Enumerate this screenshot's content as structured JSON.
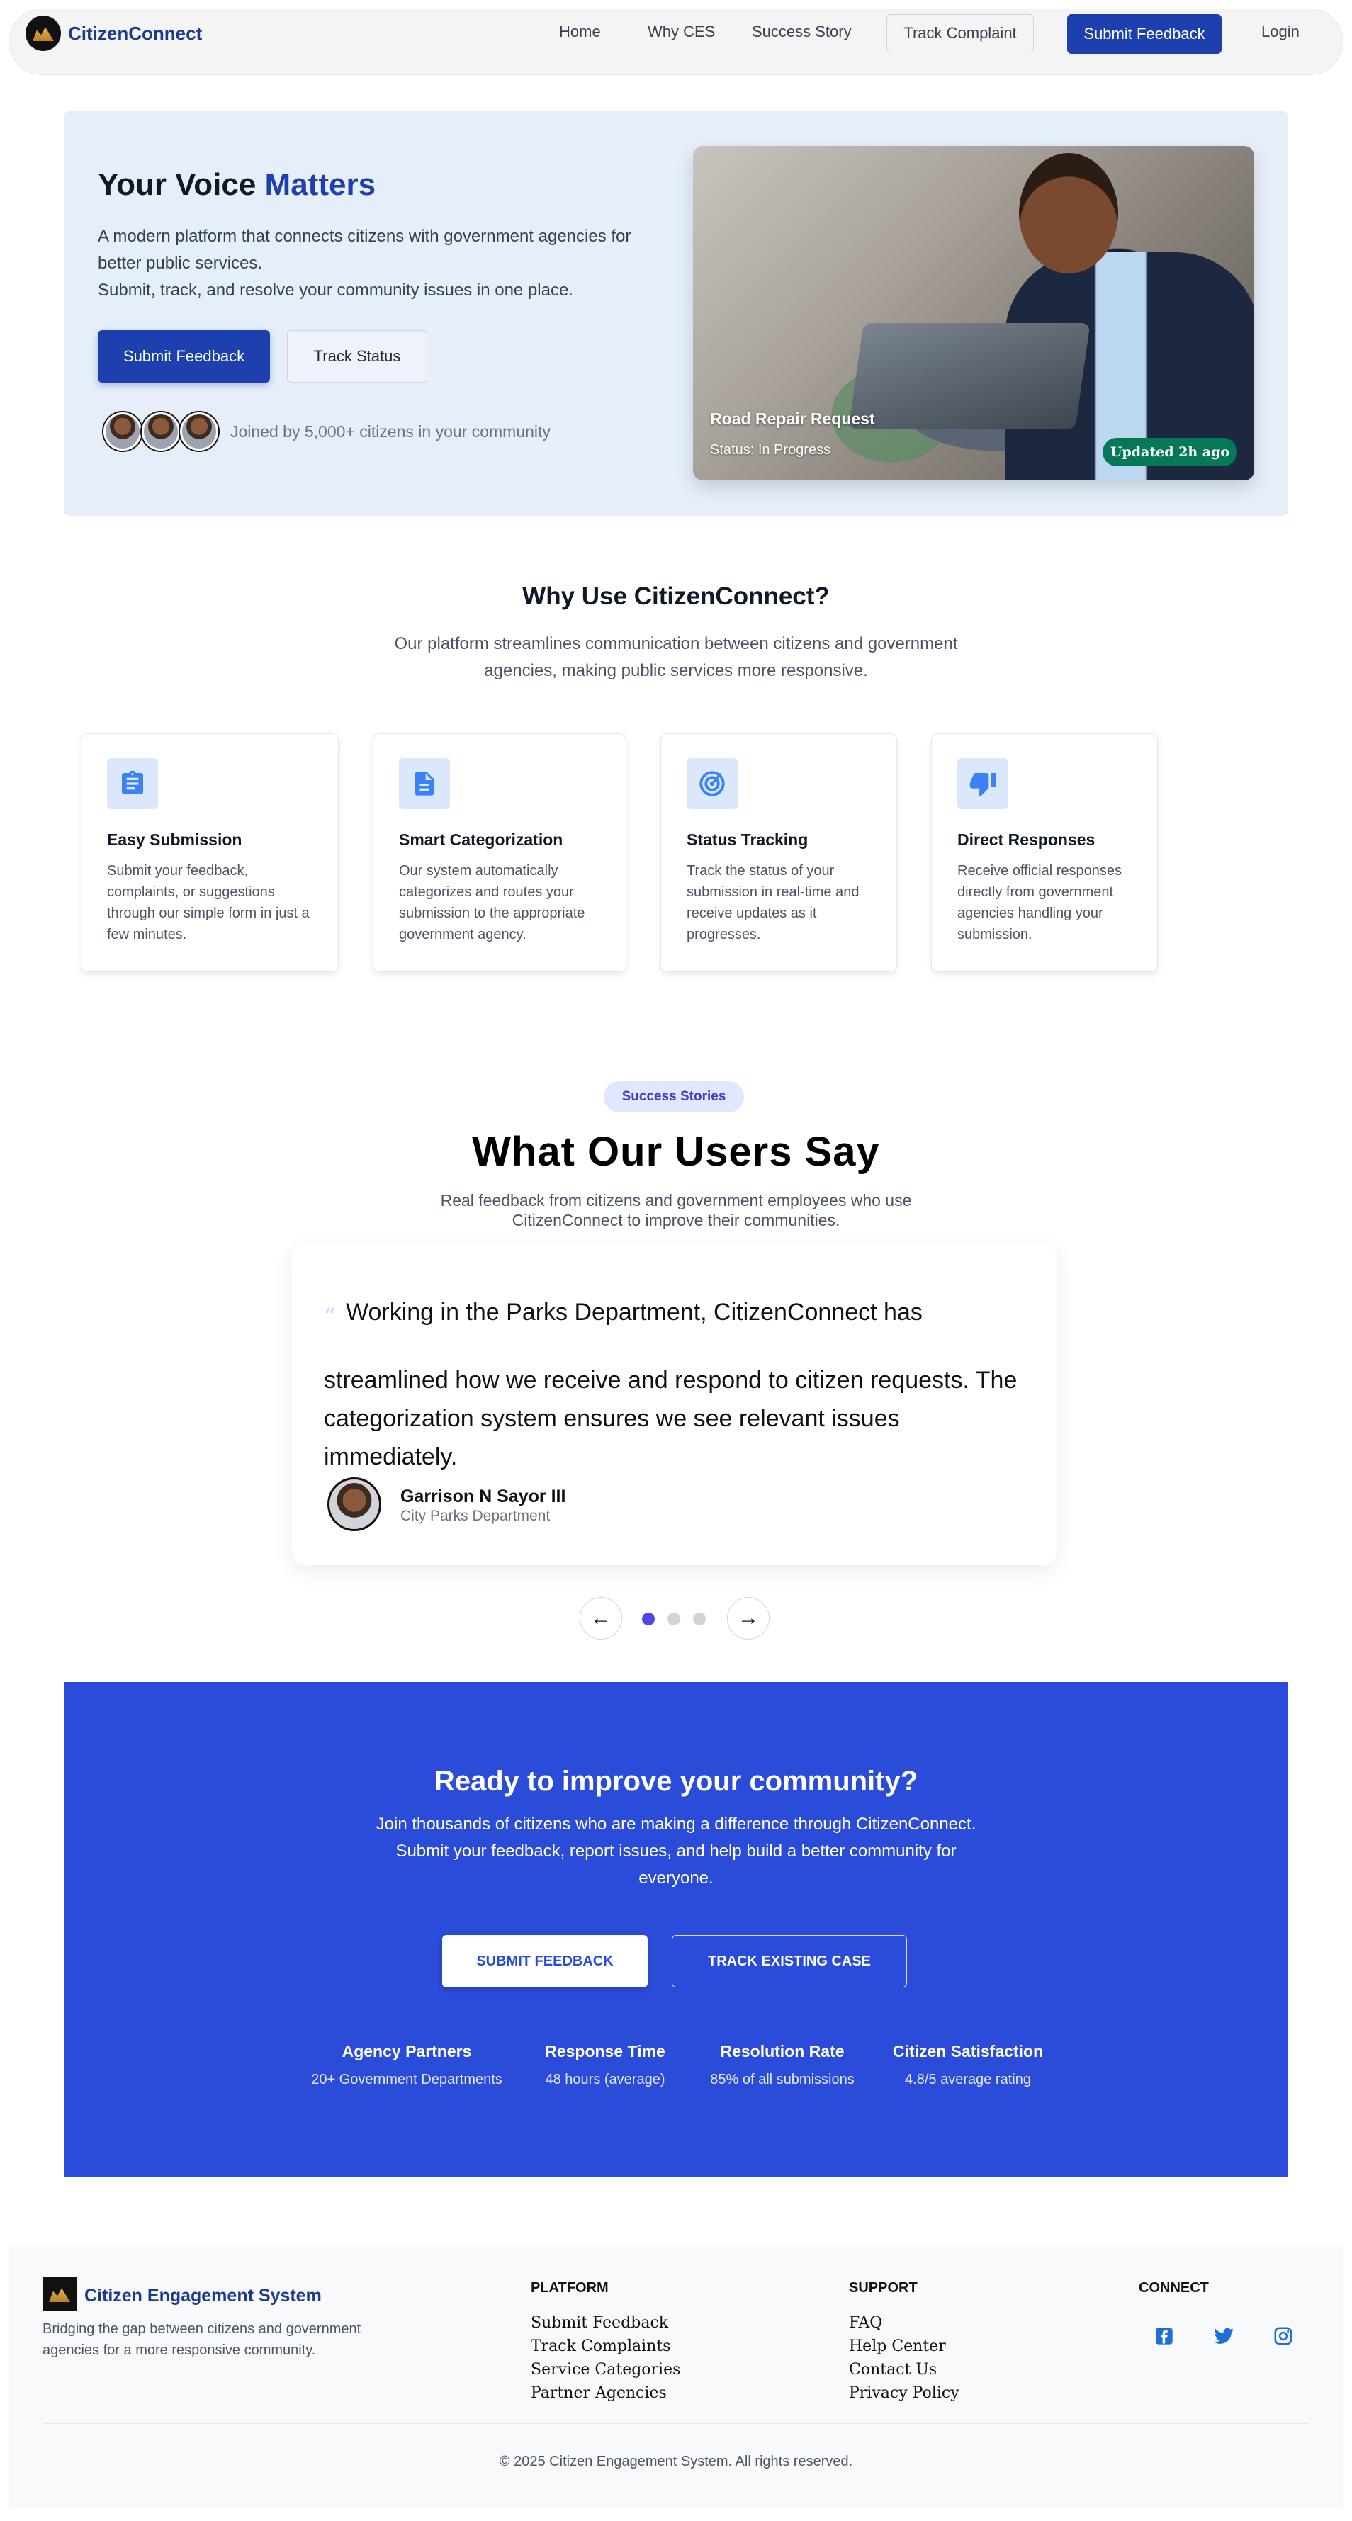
{
  "nav": {
    "brand": "CitizenConnect",
    "links": [
      "Home",
      "Why CES",
      "Success Story"
    ],
    "track": "Track Complaint",
    "submit": "Submit Feedback",
    "login": "Login"
  },
  "hero": {
    "title_plain": "Your Voice",
    "title_accent": "Matters",
    "desc_line1": "A modern platform that connects citizens with government agencies for better public services.",
    "desc_line2": "Submit, track, and resolve your community issues in one place.",
    "primary_btn": "Submit Feedback",
    "secondary_btn": "Track Status",
    "joined": "Joined by 5,000+ citizens in your community",
    "card_title": "Road Repair Request",
    "card_status": "Status: In Progress",
    "card_badge": "Updated 2h ago"
  },
  "why": {
    "title": "Why Use CitizenConnect?",
    "subtitle": "Our platform streamlines communication between citizens and government agencies, making public services more responsive.",
    "cards": [
      {
        "icon": "clipboard-icon",
        "title": "Easy Submission",
        "desc": "Submit your feedback, complaints, or suggestions through our simple form in just a few minutes."
      },
      {
        "icon": "document-icon",
        "title": "Smart Categorization",
        "desc": "Our system automatically categorizes and routes your submission to the appropriate government agency."
      },
      {
        "icon": "target-icon",
        "title": "Status Tracking",
        "desc": "Track the status of your submission in real-time and receive updates as it progresses."
      },
      {
        "icon": "thumbs-down-icon",
        "title": "Direct Responses",
        "desc": "Receive official responses directly from government agencies handling your submission."
      }
    ]
  },
  "testimonials": {
    "pill": "Success Stories",
    "title": "What Our Users Say",
    "subtitle": "Real feedback from citizens and government employees who use CitizenConnect to improve their communities.",
    "quote_line1": "Working in the Parks Department, CitizenConnect has",
    "quote_rest": "streamlined how we receive and respond to citizen requests. The categorization system ensures we see relevant issues immediately.",
    "author": "Garrison N Sayor III",
    "dept": "City Parks Department",
    "prev": "←",
    "next": "→",
    "active_slide": 1,
    "slide_count": 3
  },
  "cta": {
    "title": "Ready to improve your community?",
    "text": "Join thousands of citizens who are making a difference through CitizenConnect. Submit your feedback, report issues, and help build a better community for everyone.",
    "btn1": "SUBMIT FEEDBACK",
    "btn2": "TRACK EXISTING CASE",
    "stats": [
      {
        "label": "Agency Partners",
        "value": "20+ Government Departments"
      },
      {
        "label": "Response Time",
        "value": "48 hours (average)"
      },
      {
        "label": "Resolution Rate",
        "value": "85% of all submissions"
      },
      {
        "label": "Citizen Satisfaction",
        "value": "4.8/5 average rating"
      }
    ]
  },
  "footer": {
    "brand": "Citizen Engagement System",
    "desc": "Bridging the gap between citizens and government agencies for a more responsive community.",
    "platform_head": "PLATFORM",
    "platform_links": [
      "Submit Feedback",
      "Track Complaints",
      "Service Categories",
      "Partner Agencies"
    ],
    "support_head": "SUPPORT",
    "support_links": [
      "FAQ",
      "Help Center",
      "Contact Us",
      "Privacy Policy"
    ],
    "connect_head": "CONNECT",
    "social": [
      "facebook-icon",
      "twitter-icon",
      "instagram-icon"
    ],
    "copyright": "© 2025 Citizen Engagement System. All rights reserved."
  },
  "colors": {
    "primary": "#1e40af",
    "cta_bg": "#2b4bd9",
    "hero_bg": "#e5eef9",
    "badge_green": "#047857",
    "icon_blue": "#3b82f6"
  }
}
